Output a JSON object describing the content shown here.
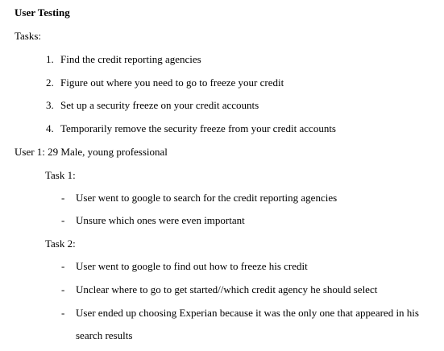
{
  "document": {
    "title": "User Testing",
    "tasks_label": "Tasks:",
    "tasks": [
      {
        "num": "1.",
        "text": "Find the credit reporting agencies"
      },
      {
        "num": "2.",
        "text": "Figure out where you need to go to freeze your credit"
      },
      {
        "num": "3.",
        "text": "Set up a security freeze on your credit accounts"
      },
      {
        "num": "4.",
        "text": "Temporarily remove the security freeze from your credit accounts"
      }
    ],
    "user1": {
      "heading": "User 1: 29 Male, young professional",
      "task1": {
        "label": "Task 1:",
        "bullets": [
          "User went to google to search for the credit reporting agencies",
          "Unsure which ones were even important"
        ]
      },
      "task2": {
        "label": "Task 2:",
        "bullets": [
          "User went to google to find out how to freeze his credit",
          "Unclear where to go to get started//which credit agency he should select",
          "User ended up choosing Experian because it was the only one that appeared in his",
          "search results"
        ]
      }
    },
    "bullet_marker": "-"
  }
}
